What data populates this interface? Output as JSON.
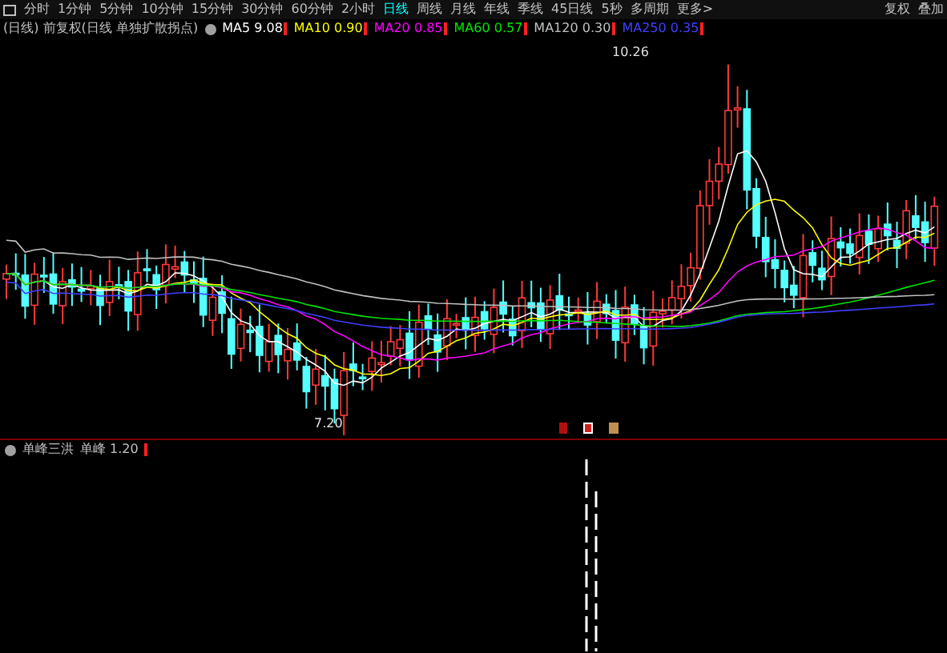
{
  "period_tabs": [
    {
      "label": "分时",
      "selected": false
    },
    {
      "label": "1分钟",
      "selected": false
    },
    {
      "label": "5分钟",
      "selected": false
    },
    {
      "label": "10分钟",
      "selected": false
    },
    {
      "label": "15分钟",
      "selected": false
    },
    {
      "label": "30分钟",
      "selected": false
    },
    {
      "label": "60分钟",
      "selected": false
    },
    {
      "label": "2小时",
      "selected": false
    },
    {
      "label": "日线",
      "selected": true
    },
    {
      "label": "周线",
      "selected": false
    },
    {
      "label": "月线",
      "selected": false
    },
    {
      "label": "年线",
      "selected": false
    },
    {
      "label": "季线",
      "selected": false
    },
    {
      "label": "45日线",
      "selected": false
    },
    {
      "label": "5秒",
      "selected": false
    },
    {
      "label": "多周期",
      "selected": false
    },
    {
      "label": "更多>",
      "selected": false
    }
  ],
  "toolbar_right": [
    "复权",
    "叠加"
  ],
  "main_legend": {
    "title": "(日线) 前复权(日线 单独扩散拐点)",
    "indicators": [
      {
        "name": "MA5",
        "value": "9.08",
        "color": "#ffffff"
      },
      {
        "name": "MA10",
        "value": "0.90",
        "color": "#ffff00"
      },
      {
        "name": "MA20",
        "value": "0.85",
        "color": "#ff00ff"
      },
      {
        "name": "MA60",
        "value": "0.57",
        "color": "#00e600"
      },
      {
        "name": "MA120",
        "value": "0.30",
        "color": "#c0c0c0"
      },
      {
        "name": "MA250",
        "value": "0.35",
        "color": "#4040ff"
      }
    ]
  },
  "price_labels": {
    "high": "10.26",
    "low": "7.20"
  },
  "sub_legend": {
    "title": "单峰三洪",
    "indicator": "单峰",
    "value": "1.20"
  }
}
